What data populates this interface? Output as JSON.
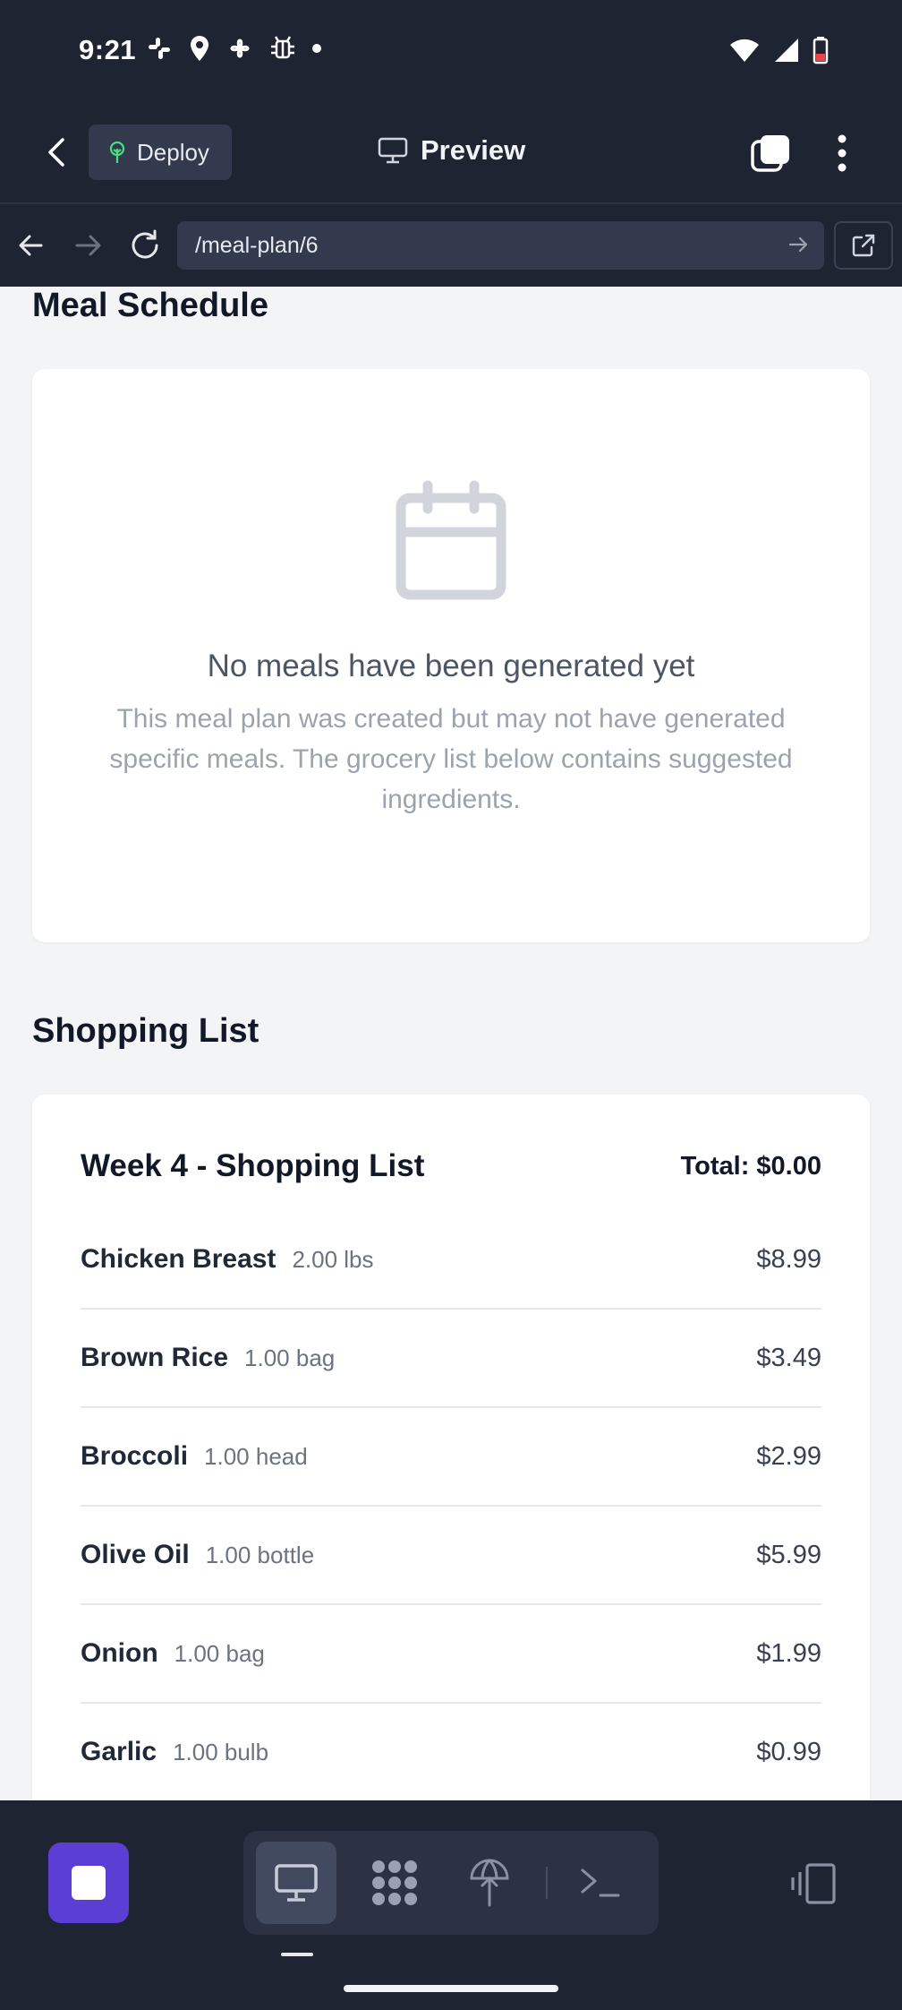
{
  "status": {
    "time": "9:21",
    "notification_icons": [
      "slack-icon",
      "location-icon",
      "pinwheel-icon",
      "bug-icon",
      "dot-icon"
    ],
    "right_icons": [
      "wifi-icon",
      "signal-icon",
      "battery-icon"
    ]
  },
  "toolbar": {
    "deploy_label": "Deploy",
    "preview_label": "Preview"
  },
  "urlbar": {
    "url": "/meal-plan/6"
  },
  "schedule": {
    "title": "Meal Schedule",
    "empty_title": "No meals have been generated yet",
    "empty_description": "This meal plan was created but may not have generated specific meals. The grocery list below contains suggested ingredients."
  },
  "shopping": {
    "section_title": "Shopping List",
    "list_title": "Week 4 - Shopping List",
    "total": "Total: $0.00",
    "items": [
      {
        "name": "Chicken Breast",
        "qty": "2.00 lbs",
        "price": "$8.99"
      },
      {
        "name": "Brown Rice",
        "qty": "1.00 bag",
        "price": "$3.49"
      },
      {
        "name": "Broccoli",
        "qty": "1.00 head",
        "price": "$2.99"
      },
      {
        "name": "Olive Oil",
        "qty": "1.00 bottle",
        "price": "$5.99"
      },
      {
        "name": "Onion",
        "qty": "1.00 bag",
        "price": "$1.99"
      },
      {
        "name": "Garlic",
        "qty": "1.00 bulb",
        "price": "$0.99"
      }
    ]
  },
  "bottom": {
    "tabs": [
      "desktop-icon",
      "apps-icon",
      "deploy-icon",
      "terminal-icon"
    ],
    "accent": "#5b3fd4"
  }
}
